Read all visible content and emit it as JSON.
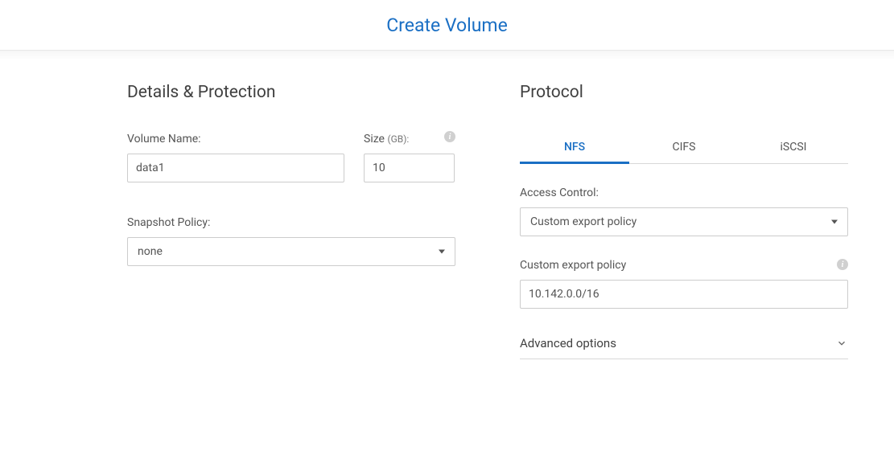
{
  "header": {
    "title": "Create Volume"
  },
  "left": {
    "section_title": "Details & Protection",
    "volume_name": {
      "label": "Volume Name:",
      "value": "data1"
    },
    "size": {
      "label": "Size",
      "unit": "(GB):",
      "value": "10"
    },
    "snapshot_policy": {
      "label": "Snapshot Policy:",
      "value": "none"
    }
  },
  "right": {
    "section_title": "Protocol",
    "tabs": [
      {
        "label": "NFS",
        "active": true
      },
      {
        "label": "CIFS",
        "active": false
      },
      {
        "label": "iSCSI",
        "active": false
      }
    ],
    "access_control": {
      "label": "Access Control:",
      "value": "Custom export policy"
    },
    "custom_export": {
      "label": "Custom export policy",
      "value": "10.142.0.0/16"
    },
    "advanced": {
      "label": "Advanced options"
    }
  }
}
